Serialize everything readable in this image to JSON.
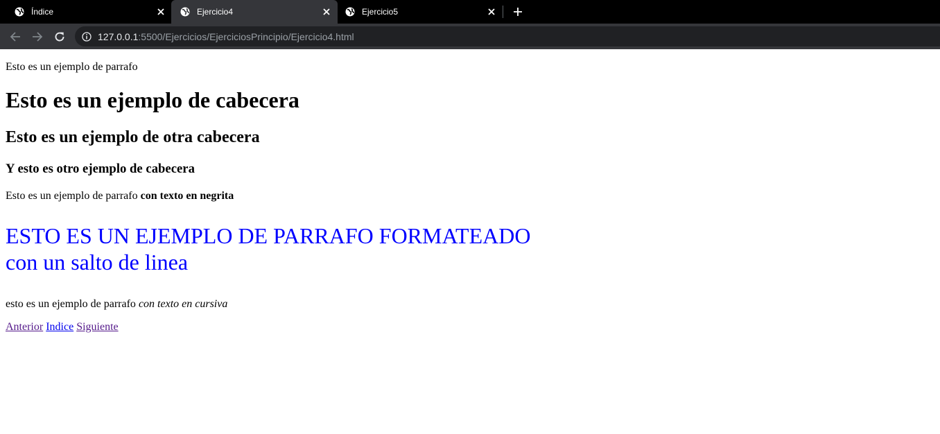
{
  "browser": {
    "tabs": [
      {
        "title": "Índice",
        "active": false,
        "icon": "globe-icon"
      },
      {
        "title": "Ejercicio4",
        "active": true,
        "icon": "globe-icon"
      },
      {
        "title": "Ejercicio5",
        "active": false,
        "icon": "globe-icon"
      }
    ],
    "address": {
      "host": "127.0.0.1",
      "rest": ":5500/Ejercicios/EjerciciosPrincipio/Ejercicio4.html"
    },
    "colors": {
      "tabstrip_bg": "#000000",
      "toolbar_bg": "#35363a",
      "omnibox_bg": "#202124"
    }
  },
  "page": {
    "paragraph_1": "Esto es un ejemplo de parrafo",
    "heading_1": "Esto es un ejemplo de cabecera",
    "heading_2": "Esto es un ejemplo de otra cabecera",
    "heading_3": "Y esto es otro ejemplo de cabecera",
    "paragraph_2": {
      "text": "Esto es un ejemplo de parrafo ",
      "bold": "con texto en negrita"
    },
    "formatted": {
      "line_1": "ESTO ES UN EJEMPLO DE PARRAFO FORMATEADO",
      "line_2": "con un salto de linea",
      "color": "#0000ff"
    },
    "paragraph_3": {
      "text": "esto es un ejemplo de parrafo ",
      "italic": "con texto en cursiva"
    },
    "links": {
      "previous": "Anterior",
      "index": "Indice",
      "next": "Siguiente"
    }
  }
}
